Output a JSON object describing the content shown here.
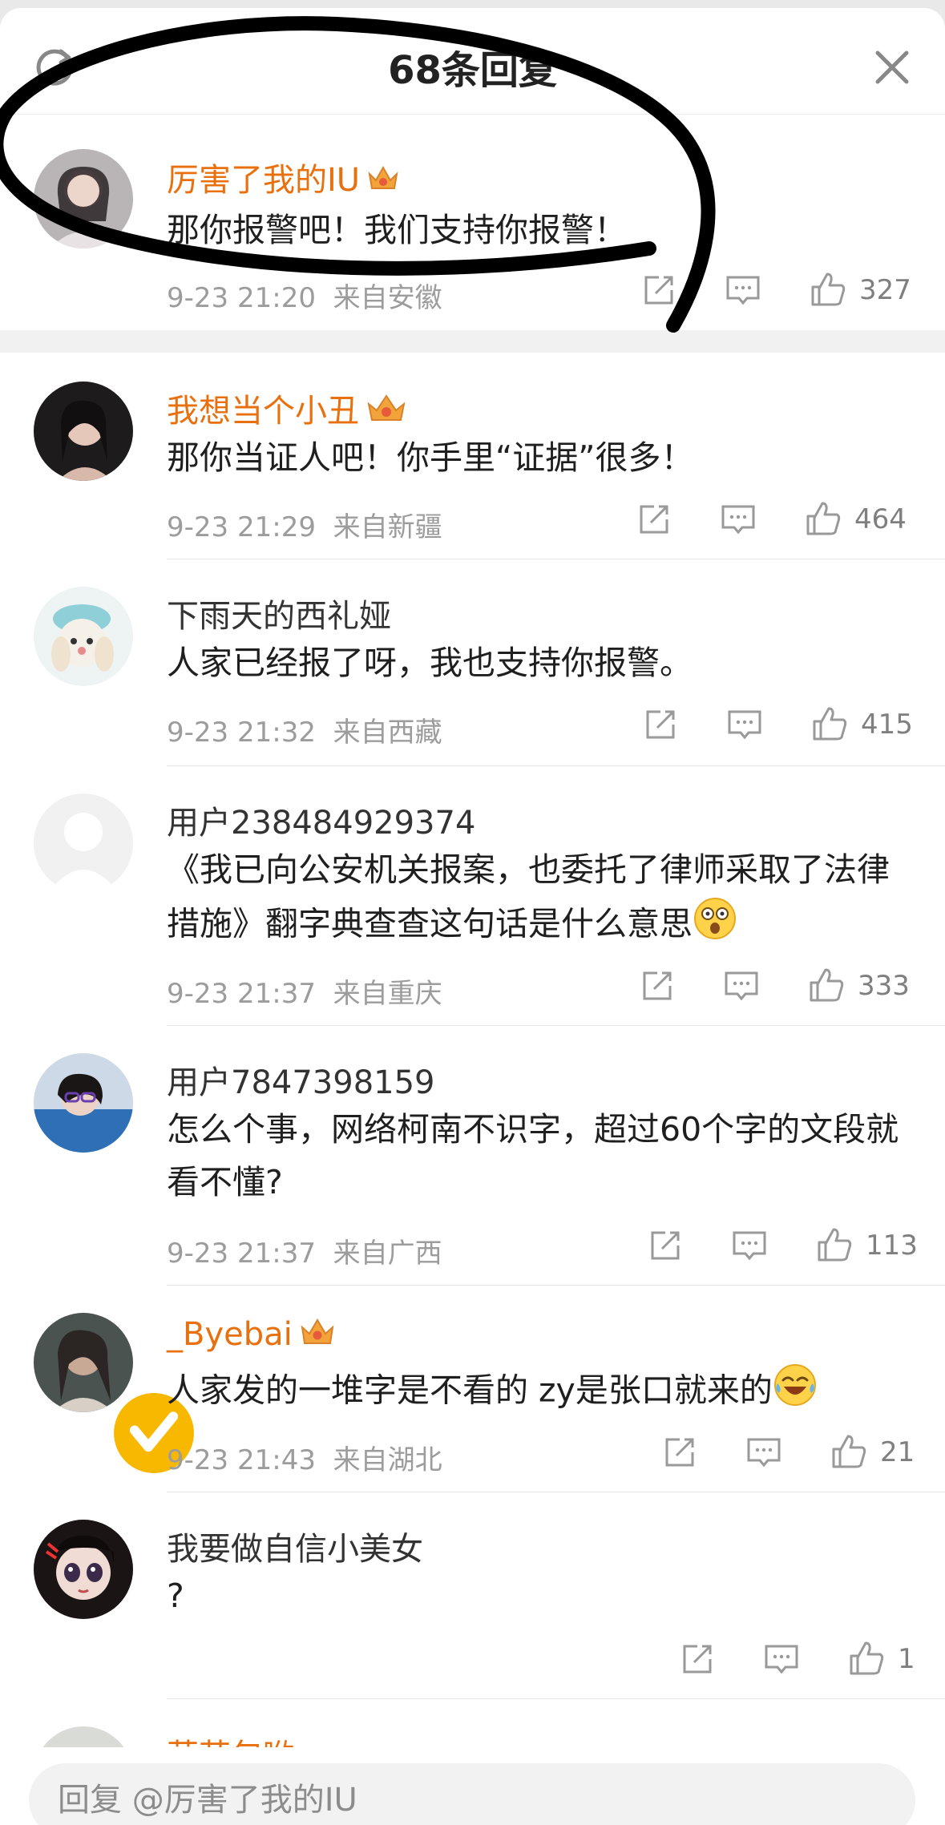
{
  "header": {
    "title": "68条回复"
  },
  "comments": [
    {
      "name": "厉害了我的IU",
      "vip": true,
      "text": "那你报警吧！我们支持你报警！",
      "time": "9-23 21:20",
      "location": "来自安徽",
      "likes": "327"
    },
    {
      "name": "我想当个小丑",
      "vip": true,
      "text": "那你当证人吧！你手里“证据”很多！",
      "time": "9-23 21:29",
      "location": "来自新疆",
      "likes": "464"
    },
    {
      "name": "下雨天的西礼娅",
      "vip": false,
      "text": "人家已经报了呀，我也支持你报警。",
      "time": "9-23 21:32",
      "location": "来自西藏",
      "likes": "415"
    },
    {
      "name": "用户238484929374",
      "vip": false,
      "text": "《我已向公安机关报案，也委托了律师采取了法律措施》翻字典查查这句话是什么意思",
      "time": "9-23 21:37",
      "location": "来自重庆",
      "likes": "333"
    },
    {
      "name": "用户7847398159",
      "vip": false,
      "text": "怎么个事，网络柯南不识字，超过60个字的文段就看不懂?",
      "time": "9-23 21:37",
      "location": "来自广西",
      "likes": "113"
    },
    {
      "name": "_Byebai",
      "vip": true,
      "text": "人家发的一堆字是不看的 zy是张口就来的",
      "time": "9-23 21:43",
      "location": "来自湖北",
      "likes": "21"
    },
    {
      "name": "我要做自信小美女",
      "vip": false,
      "text": "?",
      "time": "",
      "location": "",
      "likes": "1"
    }
  ],
  "partial_next": {
    "name": "草芸包哟"
  },
  "reply_bar": {
    "placeholder": "回复 @厉害了我的IU"
  },
  "colors": {
    "vip_name": "#e8700f",
    "annotation_stroke": "#000000"
  },
  "icons": [
    "refresh-icon",
    "close-icon",
    "share-icon",
    "comment-icon",
    "like-icon",
    "crown-icon",
    "verified-icon",
    "shocked-emoji-icon",
    "laughing-emoji-icon"
  ]
}
